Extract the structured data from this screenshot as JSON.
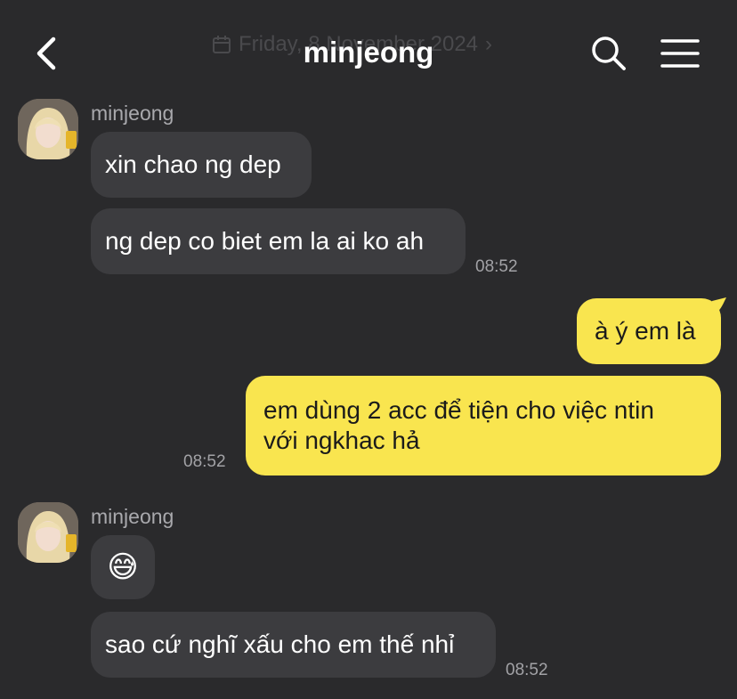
{
  "header": {
    "title": "minjeong",
    "date_banner": "Friday, 8 November 2024"
  },
  "messages": [
    {
      "sender": "minjeong",
      "text": "xin chao ng dep"
    },
    {
      "text": "ng dep co biet em la ai ko ah",
      "time": "08:52"
    },
    {
      "text": "à ý em là"
    },
    {
      "text_line1": "em dùng 2 acc để tiện cho việc ntin",
      "text_line2": "với ngkhac hả",
      "time": "08:52"
    },
    {
      "sender": "minjeong",
      "emoji": "😅"
    },
    {
      "text": "sao cứ nghĩ xấu cho em thế nhỉ",
      "time": "08:52"
    }
  ],
  "icons": {
    "back": "chevron-left-icon",
    "search": "search-icon",
    "menu": "hamburger-menu-icon",
    "calendar": "calendar-icon"
  },
  "colors": {
    "background": "#2a2a2c",
    "incoming_bubble": "#3c3c3f",
    "outgoing_bubble": "#f9e54f",
    "timestamp": "#a2a2a6"
  }
}
